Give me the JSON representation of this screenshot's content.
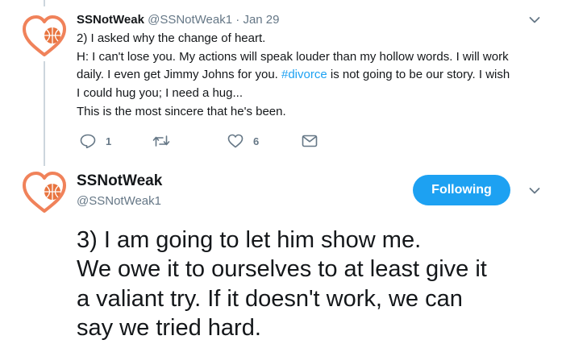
{
  "tweet1": {
    "display_name": "SSNotWeak",
    "handle": "@SSNotWeak1",
    "separator": "·",
    "date": "Jan 29",
    "lines": [
      "2) I asked why the change of heart.",
      "H: I can't lose you. My actions will speak louder than my hollow words. I will work",
      "daily. I even get Jimmy Johns for you. "
    ],
    "hashtag": "#divorce",
    "line3_after_hashtag": " is not going to be our story. I wish",
    "line4": "I could hug you; I need a hug...",
    "line5": "This is the most sincere that he's been.",
    "actions": {
      "reply_icon": "reply-icon",
      "reply_count": "1",
      "retweet_icon": "retweet-icon",
      "like_icon": "heart-icon",
      "like_count": "6",
      "dm_icon": "envelope-icon"
    }
  },
  "tweet2": {
    "display_name": "SSNotWeak",
    "handle": "@SSNotWeak1",
    "follow_button": "Following",
    "lines": [
      "3) I am going to let him show me.",
      "We owe it to ourselves to at least give it",
      "a valiant try.  If it doesn't work, we can",
      "say we tried hard."
    ]
  },
  "colors": {
    "accent": "#1da1f2",
    "secondary_text": "#657786",
    "avatar_heart": "#f0825a",
    "avatar_ball": "#e8743f"
  }
}
